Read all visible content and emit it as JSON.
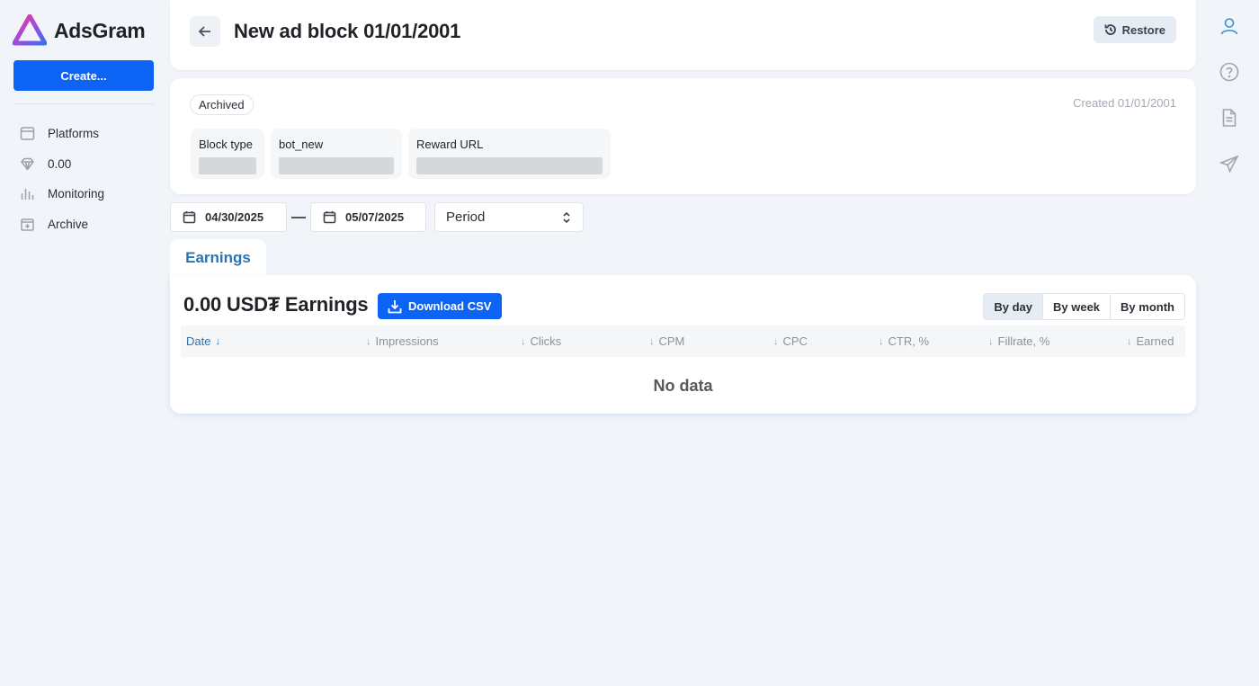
{
  "app": {
    "name": "AdsGram"
  },
  "sidebar": {
    "create_label": "Create...",
    "items": [
      {
        "label": "Platforms",
        "icon": "browser-window-icon"
      },
      {
        "label": "0.00",
        "icon": "diamond-icon"
      },
      {
        "label": "Monitoring",
        "icon": "bar-chart-icon"
      },
      {
        "label": "Archive",
        "icon": "archive-box-icon"
      }
    ]
  },
  "rail": {
    "icons": [
      "user-icon",
      "help-circle-icon",
      "document-icon",
      "telegram-send-icon"
    ],
    "active_color": "#3a8fd6"
  },
  "header": {
    "title": "New ad block 01/01/2001",
    "restore_label": "Restore"
  },
  "info": {
    "status": "Archived",
    "created": "Created 01/01/2001",
    "fields": [
      {
        "label": "Block type"
      },
      {
        "label": "bot_new"
      },
      {
        "label": "Reward URL"
      }
    ]
  },
  "filters": {
    "date_from": "04/30/2025",
    "date_to": "05/07/2025",
    "period": "Period"
  },
  "tabs": [
    {
      "label": "Earnings",
      "active": true
    }
  ],
  "earnings": {
    "title": "0.00 USD₮ Earnings",
    "download_label": "Download CSV",
    "granularity": [
      {
        "label": "By day",
        "active": true
      },
      {
        "label": "By week",
        "active": false
      },
      {
        "label": "By month",
        "active": false
      }
    ],
    "columns": [
      "Date",
      "Impressions",
      "Clicks",
      "CPM",
      "CPC",
      "CTR, %",
      "Fillrate, %",
      "Earned"
    ],
    "empty_text": "No data"
  },
  "colors": {
    "accent": "#0d63f3",
    "link": "#2a74b8",
    "background": "#f1f4f8"
  }
}
